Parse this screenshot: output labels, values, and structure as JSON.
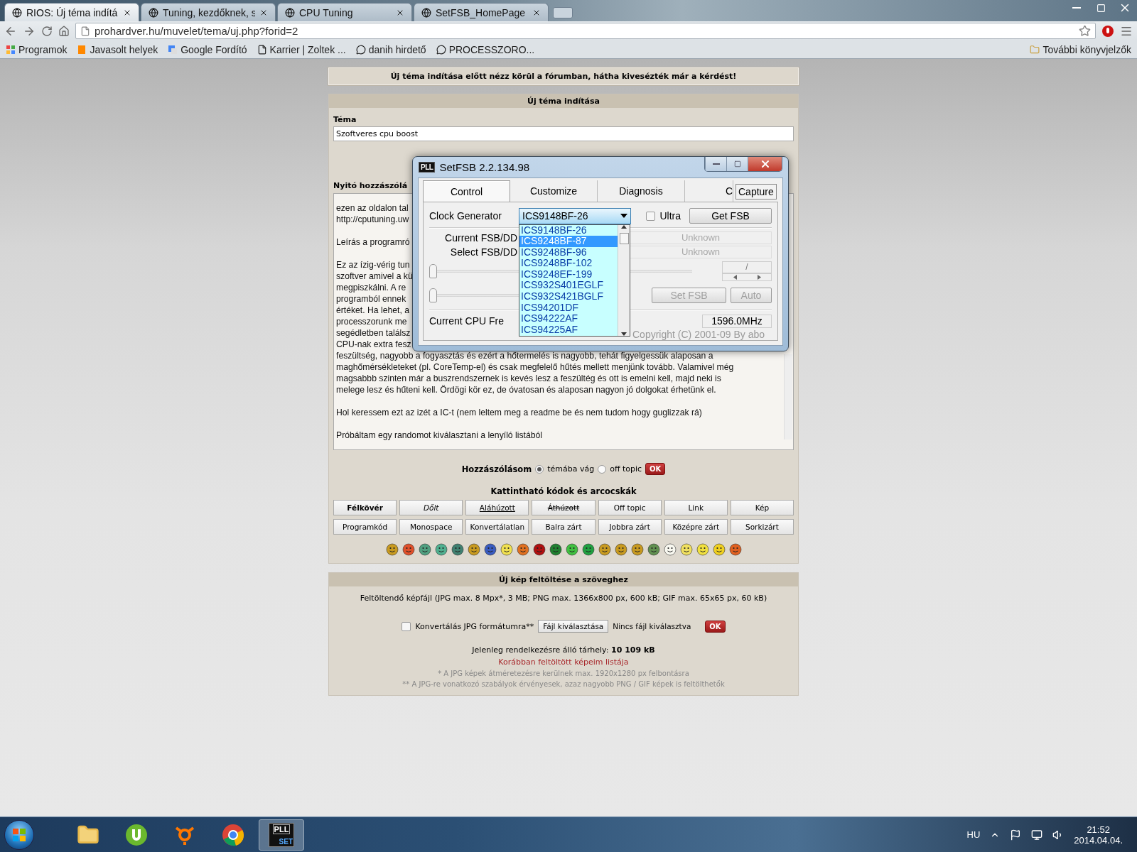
{
  "browser": {
    "tabs": [
      {
        "title": "RIOS: Új téma indítá",
        "selected": true
      },
      {
        "title": "Tuning, kezdőknek, s",
        "selected": false
      },
      {
        "title": "CPU Tuning",
        "selected": false
      },
      {
        "title": "SetFSB_HomePage",
        "selected": false
      }
    ],
    "address": "prohardver.hu/muvelet/tema/uj.php?forid=2",
    "bookmarks": [
      {
        "label": "Programok",
        "kind": "apps"
      },
      {
        "label": "Javasolt helyek",
        "kind": "site"
      },
      {
        "label": "Google Fordító",
        "kind": "translate"
      },
      {
        "label": "Karrier | Zoltek ...",
        "kind": "page"
      },
      {
        "label": "danih hirdető",
        "kind": "forum"
      },
      {
        "label": "PROCESSZORO...",
        "kind": "forum"
      }
    ],
    "other_bookmarks": "További könyvjelzők"
  },
  "notice": "Új téma indítása előtt nézz körül a fórumban, hátha kivesézték már a kérdést!",
  "new_topic": {
    "header": "Új téma indítása",
    "topic_label": "Téma",
    "topic_value": "Szoftveres cpu boost",
    "post_label": "Nyitó hozzászólá",
    "post_paragraphs": [
      [
        "ezen az oldalon tal",
        "http://cputuning.uw"
      ],
      [
        "Leírás a programró"
      ],
      [
        "Ez az ízig-vérig tun",
        "szoftver amivel a kü",
        "megpiszkálni. A re",
        "programból ennek",
        "értéket. Ha lehet, a",
        "processzorunk me",
        "segédletben találsz",
        "CPU-nak extra fesz",
        "feszültség, nagyobb a fogyasztás és ezért a hőtermelés is nagyobb, tehát figyelgessük alaposan a",
        "maghőmérsékleteket (pl. CoreTemp-el) és csak megfelelő hűtés mellett menjünk tovább. Valamivel még",
        "magsabbb szinten már a buszrendszernek is kevés lesz a feszültég és ott is emelni kell, majd neki is",
        "melege lesz és hűteni kell. Ördögi kör ez, de óvatosan és alaposan nagyon jó dolgokat érhetünk el."
      ],
      [
        "Hol keressem ezt az izét a IC-t (nem leltem meg a readme be és nem tudom hogy guglizzak rá)"
      ],
      [
        "Próbáltam egy randomot kiválasztani a lenyíló listából"
      ]
    ],
    "post_type": {
      "label": "Hozzászólásom",
      "options": [
        {
          "label": "témába vág",
          "selected": true
        },
        {
          "label": "off topic",
          "selected": false
        }
      ],
      "submit": "OK"
    },
    "codes_title": "Kattintható kódok és arcocskák",
    "code_buttons": [
      {
        "label": "Félkövér",
        "kind": "bold"
      },
      {
        "label": "Dőlt",
        "kind": "italic"
      },
      {
        "label": "Aláhúzott",
        "kind": "underline"
      },
      {
        "label": "Áthúzott",
        "kind": "strike"
      },
      {
        "label": "Off topic",
        "kind": "plain"
      },
      {
        "label": "Link",
        "kind": "plain"
      },
      {
        "label": "Kép",
        "kind": "plain"
      },
      {
        "label": "Programkód",
        "kind": "plain"
      },
      {
        "label": "Monospace",
        "kind": "plain"
      },
      {
        "label": "Konvertálatlan",
        "kind": "plain"
      },
      {
        "label": "Balra zárt",
        "kind": "plain"
      },
      {
        "label": "Jobbra zárt",
        "kind": "plain"
      },
      {
        "label": "Középre zárt",
        "kind": "plain"
      },
      {
        "label": "Sorkizárt",
        "kind": "plain"
      }
    ],
    "smileys": [
      {
        "color": "#c89a20"
      },
      {
        "color": "#e0502a"
      },
      {
        "color": "#50a080"
      },
      {
        "color": "#50b090"
      },
      {
        "color": "#408070"
      },
      {
        "color": "#c89a20"
      },
      {
        "color": "#3a5cc0"
      },
      {
        "color": "#f0e050"
      },
      {
        "color": "#e07020"
      },
      {
        "color": "#b01010"
      },
      {
        "color": "#208030"
      },
      {
        "color": "#40c040"
      },
      {
        "color": "#20a040"
      },
      {
        "color": "#c89a20"
      },
      {
        "color": "#c89a20"
      },
      {
        "color": "#c89a20"
      },
      {
        "color": "#609050"
      },
      {
        "color": "#f8f8f0"
      },
      {
        "color": "#f0e060"
      },
      {
        "color": "#f0e040"
      },
      {
        "color": "#f0d020"
      },
      {
        "color": "#e06020"
      }
    ]
  },
  "upload": {
    "header": "Új kép feltöltése a szöveghez",
    "info": "Feltöltendő képfájl (JPG max. 8 Mpx*, 3 MB; PNG max. 1366x800 px, 600 kB; GIF max. 65x65 px, 60 kB)",
    "convert": {
      "label": "Konvertálás JPG formátumra**",
      "checked": false
    },
    "choose_button": "Fájl kiválasztása",
    "no_file": "Nincs fájl kiválasztva",
    "submit": "OK",
    "storage": "Jelenleg rendelkezésre álló tárhely: **10 109 kB**",
    "list_link": "Korábban feltöltött képeim listája",
    "notes": [
      "* A JPG képek átméretezésre kerülnek max. 1920x1280 px felbontásra",
      "** A JPG-re vonatkozó szabályok érvényesek, azaz nagyobb PNG / GIF képek is feltölthetők"
    ]
  },
  "setfsb": {
    "icon_text": "PLL",
    "title": "SetFSB 2.2.134.98",
    "tabs": [
      {
        "label": "Control",
        "selected": true
      },
      {
        "label": "Customize",
        "selected": false
      },
      {
        "label": "Diagnosis",
        "selected": false
      },
      {
        "label": "C",
        "selected": false
      }
    ],
    "capture_button": "Capture",
    "clock_label": "Clock Generator",
    "clock_value": "ICS9148BF-26",
    "clock_options": [
      {
        "label": "ICS9148BF-26",
        "selected": false
      },
      {
        "label": "ICS9248BF-87",
        "selected": true
      },
      {
        "label": "ICS9248BF-96",
        "selected": false
      },
      {
        "label": "ICS9248BF-102",
        "selected": false
      },
      {
        "label": "ICS9248EF-199",
        "selected": false
      },
      {
        "label": "ICS932S401EGLF",
        "selected": false
      },
      {
        "label": "ICS932S421BGLF",
        "selected": false
      },
      {
        "label": "ICS94201DF",
        "selected": false
      },
      {
        "label": "ICS94222AF",
        "selected": false
      },
      {
        "label": "ICS94225AF",
        "selected": false
      }
    ],
    "ultra": {
      "label": "Ultra",
      "checked": false
    },
    "get_fsb": {
      "label": "Get FSB",
      "disabled": false
    },
    "readouts": [
      {
        "label": "Current FSB/DD",
        "value": "Unknown",
        "disabled": true
      },
      {
        "label": "Select FSB/DD",
        "value": "Unknown",
        "disabled": true
      }
    ],
    "sliders": [
      {
        "level": 0
      },
      {
        "level": 0
      }
    ],
    "ratio": "/",
    "set_fsb": {
      "label": "Set FSB",
      "disabled": true
    },
    "auto": {
      "label": "Auto",
      "disabled": true
    },
    "cpu_label": "Current CPU Fre",
    "cpu_value": "1596.0MHz",
    "copyright": "Copyright (C) 2001-09 By abo"
  },
  "taskbar": {
    "apps": [
      {
        "kind": "explorer",
        "active": false
      },
      {
        "kind": "torrent",
        "active": false
      },
      {
        "kind": "antivirus",
        "active": false
      },
      {
        "kind": "browser",
        "active": false
      },
      {
        "kind": "setfsb",
        "active": true
      }
    ],
    "setfsb_icon_text": [
      "PLL",
      "SET"
    ],
    "language": "HU",
    "time": "21:52",
    "date": "2014.04.04."
  }
}
